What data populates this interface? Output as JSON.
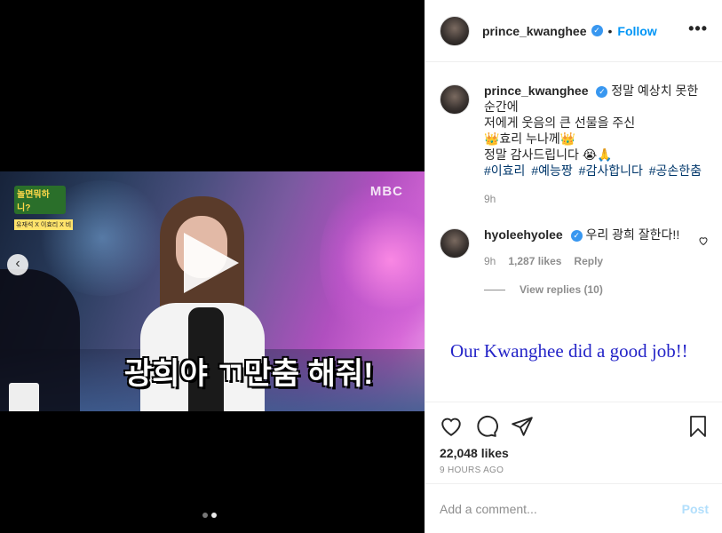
{
  "media": {
    "show_logo_title": "놀면뭐하니?",
    "show_logo_sub": "유재석 X 이효리 X 비",
    "broadcaster": "MBC",
    "caption": "광희야 ㄲ만춤 해줘!",
    "prev_icon": "chevron-left-icon",
    "play_icon": "play-icon",
    "carousel_dots": 2,
    "carousel_active": 2
  },
  "header": {
    "username": "prince_kwanghee",
    "verified_icon": "verified-badge-icon",
    "separator": "•",
    "follow_label": "Follow",
    "more_label": "•••"
  },
  "caption_post": {
    "username": "prince_kwanghee",
    "line1": "정말 예상치 못한 순간에",
    "line2": "저에게 웃음의 큰 선물을 주신",
    "line3": "👑효리 누나께👑",
    "line4": "정말 감사드립니다 😭🙏",
    "hashtags": [
      "#이효리",
      "#예능짱",
      "#감사합니다",
      "#공손한춤"
    ],
    "time": "9h"
  },
  "comment": {
    "username": "hyoleehyolee",
    "text": "우리 광희 잘한다!!",
    "time": "9h",
    "likes": "1,287 likes",
    "reply_label": "Reply",
    "view_replies": "View replies (10)"
  },
  "annotation": {
    "text": "Our Kwanghee did a good job!!",
    "color": "#2525c8"
  },
  "actions": {
    "like_icon": "heart-icon",
    "comment_icon": "comment-icon",
    "share_icon": "paper-plane-icon",
    "save_icon": "bookmark-icon",
    "likes_count": "22,048 likes",
    "timestamp": "9 HOURS AGO"
  },
  "add_comment": {
    "placeholder": "Add a comment...",
    "post_label": "Post"
  },
  "colors": {
    "link_blue": "#0095f6",
    "hashtag": "#00376b",
    "muted": "#8e8e8e",
    "post_disabled": "#b2dffc"
  }
}
